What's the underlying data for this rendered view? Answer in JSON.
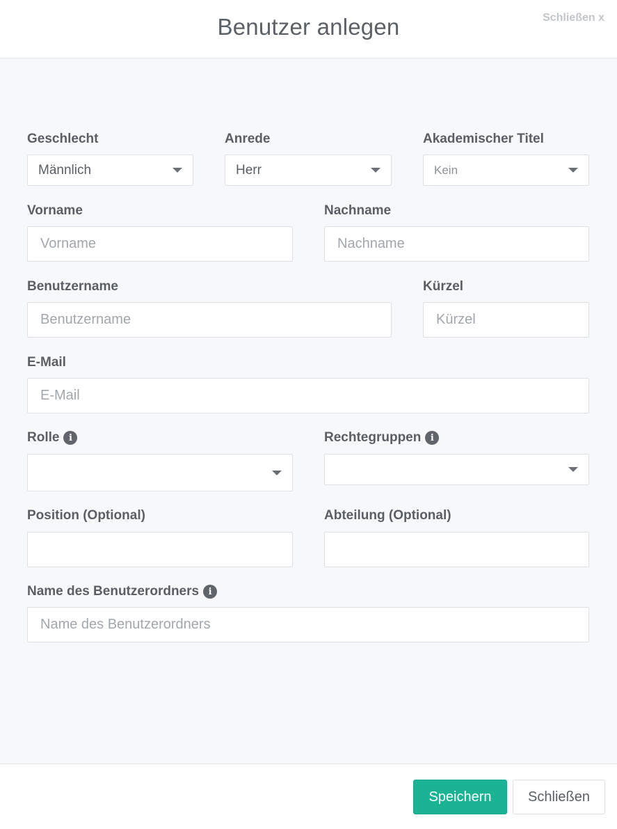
{
  "header": {
    "title": "Benutzer anlegen",
    "close_label": "Schließen x"
  },
  "form": {
    "geschlecht": {
      "label": "Geschlecht",
      "value": "Männlich"
    },
    "anrede": {
      "label": "Anrede",
      "value": "Herr"
    },
    "titel": {
      "label": "Akademischer Titel",
      "value": "Kein"
    },
    "vorname": {
      "label": "Vorname",
      "placeholder": "Vorname"
    },
    "nachname": {
      "label": "Nachname",
      "placeholder": "Nachname"
    },
    "benutzername": {
      "label": "Benutzername",
      "placeholder": "Benutzername"
    },
    "kuerzel": {
      "label": "Kürzel",
      "placeholder": "Kürzel"
    },
    "email": {
      "label": "E-Mail",
      "placeholder": "E-Mail"
    },
    "rolle": {
      "label": "Rolle",
      "value": ""
    },
    "rechtegruppen": {
      "label": "Rechtegruppen",
      "value": ""
    },
    "position": {
      "label": "Position (Optional)",
      "placeholder": ""
    },
    "abteilung": {
      "label": "Abteilung (Optional)",
      "placeholder": ""
    },
    "ordner": {
      "label": "Name des Benutzerordners",
      "placeholder": "Name des Benutzerordners"
    }
  },
  "info_glyph": "i",
  "footer": {
    "save_label": "Speichern",
    "close_label": "Schließen"
  },
  "colors": {
    "primary": "#1ab394",
    "background": "#f7f8fa",
    "border": "#dde0e4",
    "text": "#595f65"
  },
  "icons": {
    "dropdown": "caret-down-icon",
    "info": "info-circle-icon"
  }
}
